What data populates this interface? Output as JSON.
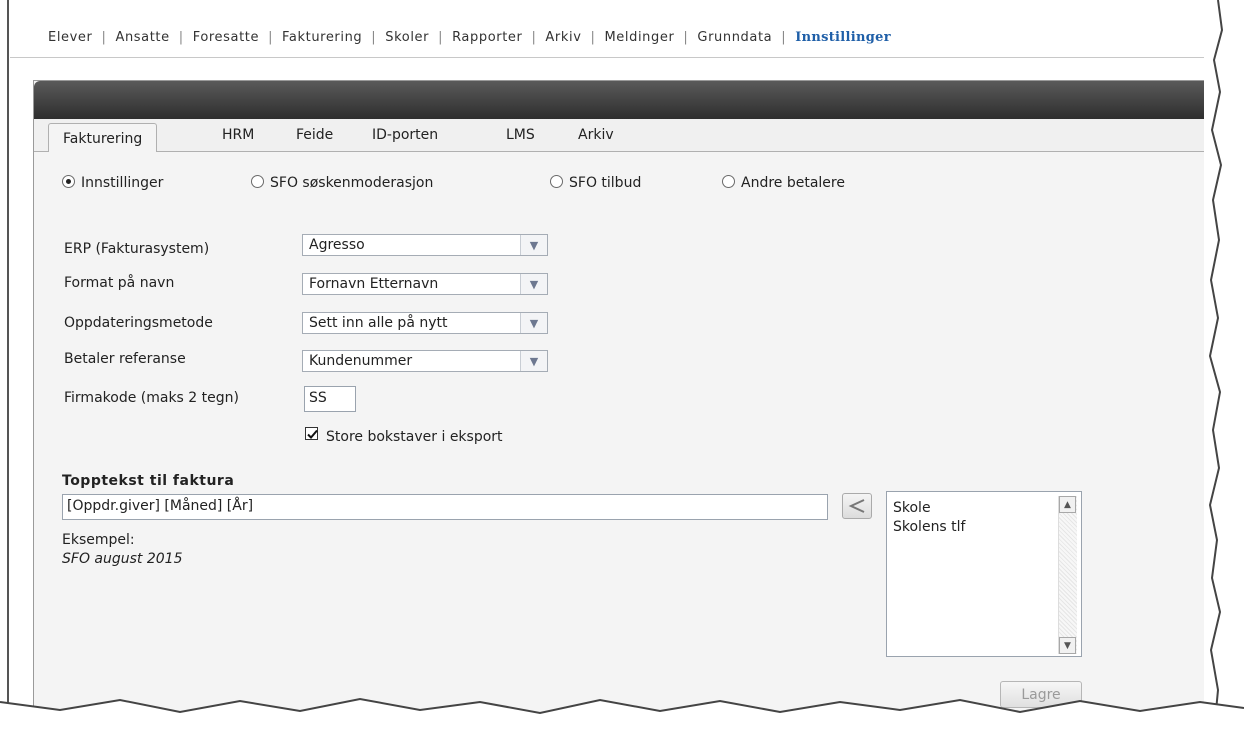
{
  "topnav": {
    "items": [
      "Elever",
      "Ansatte",
      "Foresatte",
      "Fakturering",
      "Skoler",
      "Rapporter",
      "Arkiv",
      "Meldinger",
      "Grunndata",
      "Innstillinger"
    ],
    "active": "Innstillinger"
  },
  "tabs": [
    "Fakturering",
    "HRM",
    "Feide",
    "ID-porten",
    "LMS",
    "Arkiv"
  ],
  "radios": {
    "innstillinger": "Innstillinger",
    "soskenmoderasjon": "SFO søskenmoderasjon",
    "tilbud": "SFO tilbud",
    "andre": "Andre betalere",
    "selected": "Innstillinger"
  },
  "form": {
    "erp_label": "ERP (Fakturasystem)",
    "erp_value": "Agresso",
    "name_format_label": "Format på navn",
    "name_format_value": "Fornavn Etternavn",
    "update_method_label": "Oppdateringsmetode",
    "update_method_value": "Sett inn alle på nytt",
    "payer_ref_label": "Betaler referanse",
    "payer_ref_value": "Kundenummer",
    "company_code_label": "Firmakode (maks 2 tegn)",
    "company_code_value": "SS",
    "uppercase_label": "Store bokstaver i eksport",
    "uppercase_checked": true
  },
  "header_text": {
    "title": "Topptekst til faktura",
    "value": "[Oppdr.giver] [Måned] [År]",
    "example_label": "Eksempel:",
    "example_value": "SFO august 2015",
    "tokens": [
      "Skole",
      "Skolens tlf"
    ]
  },
  "save_label": "Lagre",
  "icons": {
    "insert": "arrow-left-icon",
    "dropdown": "chevron-down-icon"
  }
}
